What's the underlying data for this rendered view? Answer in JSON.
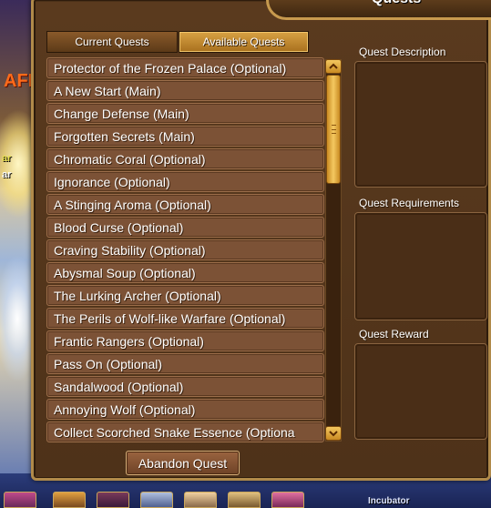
{
  "window": {
    "title": "Quests"
  },
  "tabs": {
    "current": "Current Quests",
    "available": "Available Quests"
  },
  "quests": [
    "Protector of the Frozen Palace (Optional)",
    "A New Start (Main)",
    "Change Defense (Main)",
    "Forgotten Secrets (Main)",
    "Chromatic Coral (Optional)",
    "Ignorance (Optional)",
    "A Stinging Aroma (Optional)",
    "Blood Curse (Optional)",
    "Craving Stability (Optional)",
    "Abysmal Soup (Optional)",
    "The Lurking Archer (Optional)",
    "The Perils of Wolf-like Warfare (Optional)",
    "Frantic Rangers (Optional)",
    "Pass On (Optional)",
    "Sandalwood (Optional)",
    "Annoying Wolf (Optional)",
    "Collect Scorched Snake Essence (Optiona"
  ],
  "panels": {
    "description": "Quest Description",
    "requirements": "Quest Requirements",
    "reward": "Quest Reward"
  },
  "actions": {
    "abandon": "Abandon Quest"
  },
  "scene": {
    "afk_badge": "AFK",
    "name_tag_1": "ar",
    "name_tag_2": "ar",
    "incubator_label": "Incubator"
  },
  "colors": {
    "window_bg": "#5a3a1e",
    "row_bg": "#7c5236",
    "accent_gold": "#d8a244",
    "border_gold": "#b08a4a"
  }
}
